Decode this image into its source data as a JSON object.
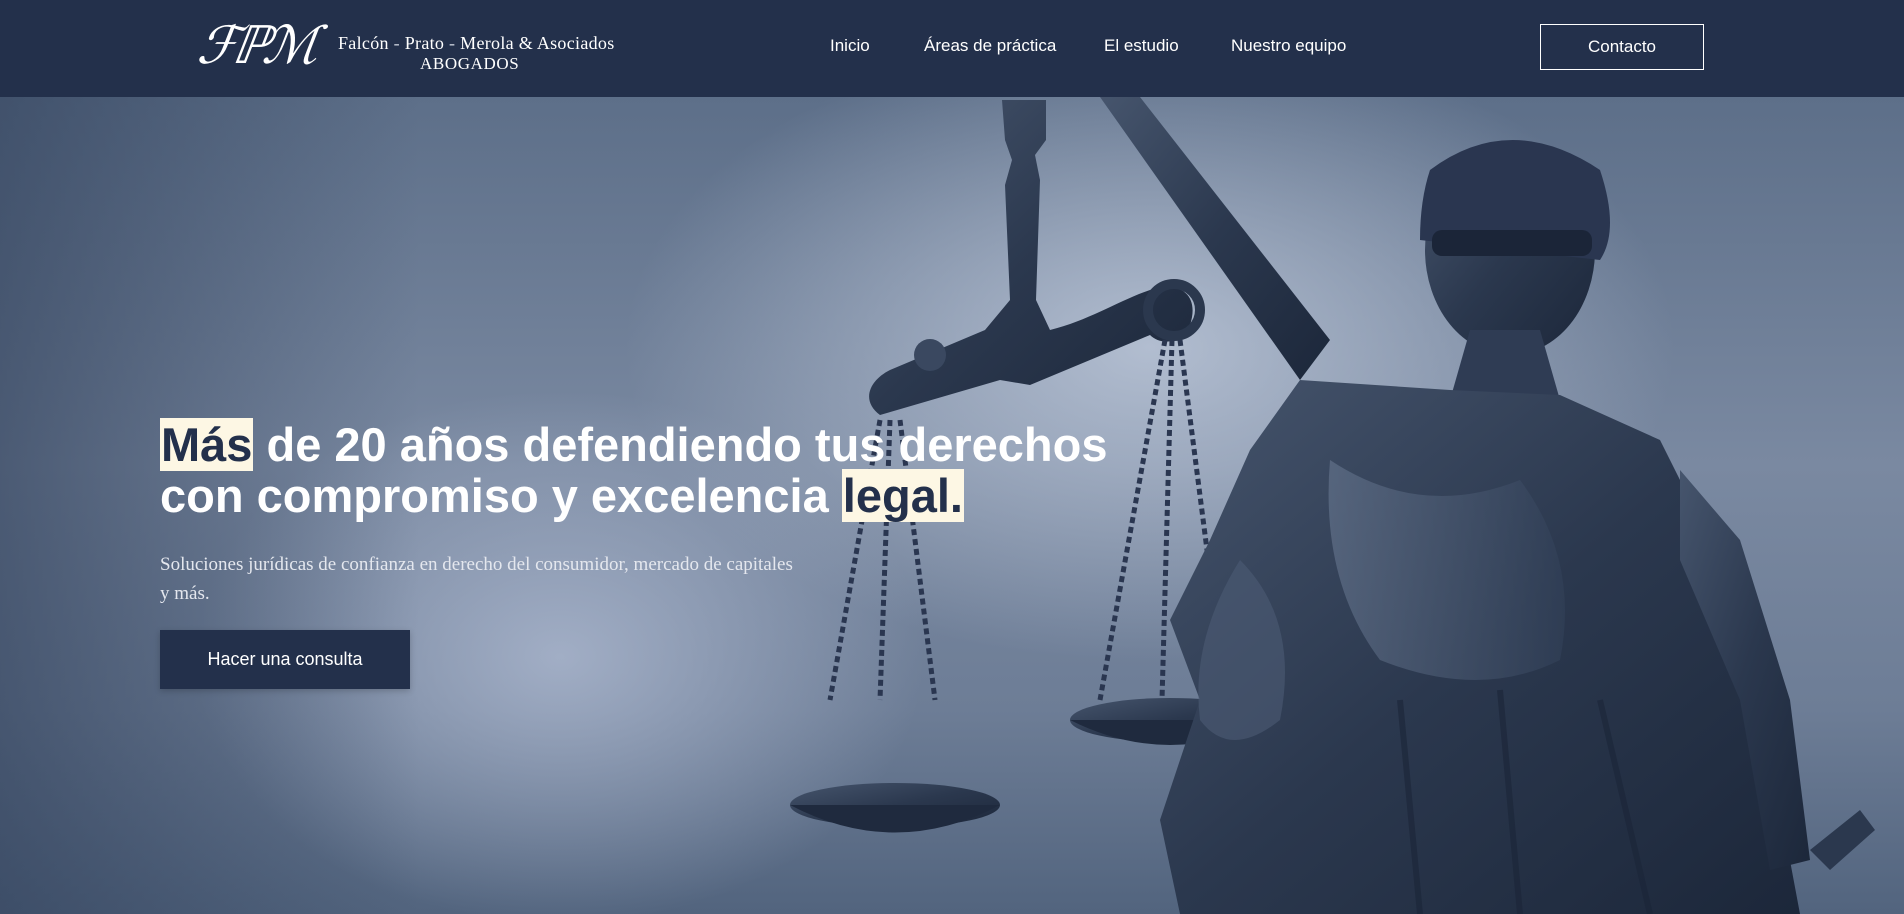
{
  "brand": {
    "monogram": "FPM",
    "firm_part1": "Falcón",
    "firm_part2": "Prato",
    "firm_part3": "Merola & Asociados",
    "separator": "-",
    "subtitle": "ABOGADOS"
  },
  "nav": {
    "items": [
      {
        "label": "Inicio"
      },
      {
        "label": "Áreas de práctica"
      },
      {
        "label": "El estudio"
      },
      {
        "label": "Nuestro equipo"
      }
    ],
    "contact_label": "Contacto"
  },
  "hero": {
    "headline_highlight_1": "Más",
    "headline_middle": " de 20 años defendiendo tus derechos con compromiso y excelencia ",
    "headline_highlight_2": "legal.",
    "subtitle": "Soluciones jurídicas de confianza en derecho del consumidor, mercado de capitales y más.",
    "cta_label": "Hacer una consulta",
    "image_subject": "lady-justice-statue"
  },
  "colors": {
    "navy": "#23304b",
    "highlight": "#fdf7e4",
    "white": "#ffffff"
  }
}
